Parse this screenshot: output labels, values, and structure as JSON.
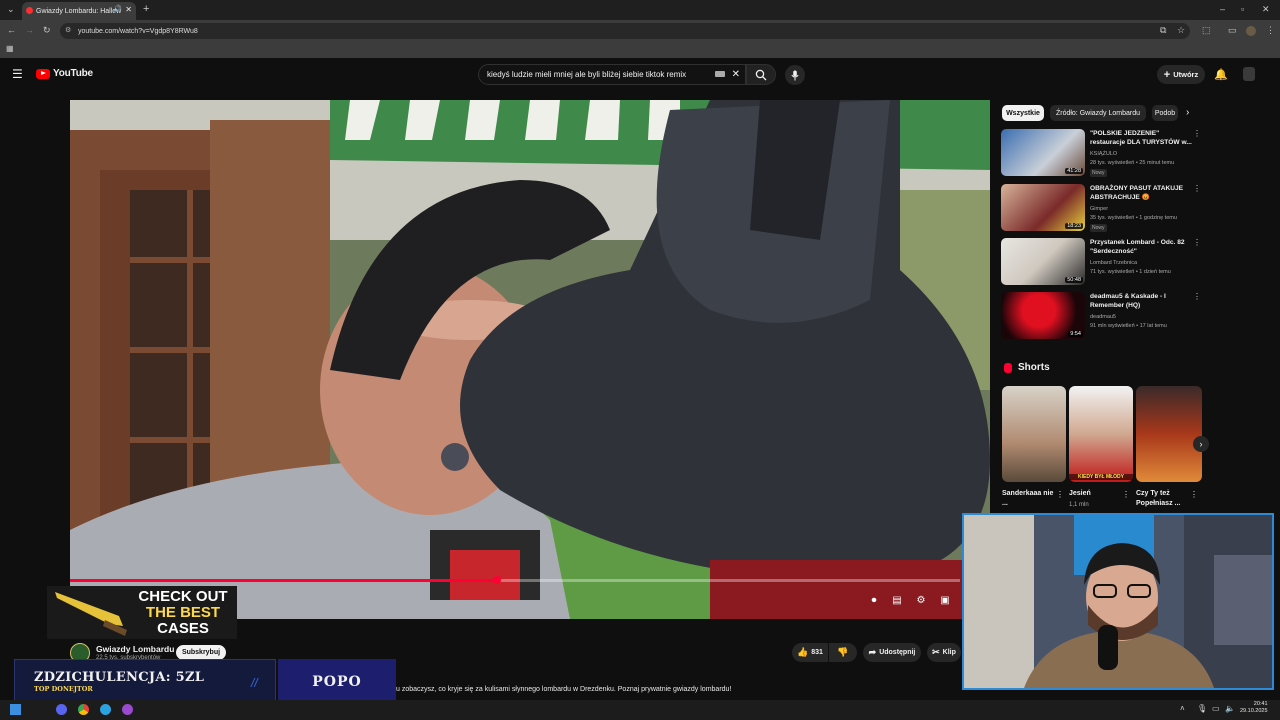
{
  "browser": {
    "tab_title": "Gwiazdy Lombardu: Hallow",
    "url": "youtube.com/watch?v=Vgdp8Y8RWu8"
  },
  "masthead": {
    "logo": "YouTube",
    "search_value": "kiedyś ludzie mieli mniej ale byli bliżej siebie tiktok remix",
    "create_label": "Utwórz"
  },
  "video": {
    "progress": 0.48,
    "accent": "#ff0033"
  },
  "channel": {
    "name": "Gwiazdy Lombardu",
    "subs": "22,5 tys. subskrybentów",
    "subscribe_label": "Subskrybuj"
  },
  "actions": {
    "likes": "831",
    "share_label": "Udostępnij",
    "clip_label": "Klip"
  },
  "description": "u zobaczysz, co kryje się za kulisami słynnego lombardu w Drezdenku. Poznaj prywatnie gwiazdy lombardu!",
  "chips": [
    "Wszystkie",
    "Źródło: Gwiazdy Lombardu",
    "Podob"
  ],
  "recommendations": [
    {
      "title": "\"POLSKIE JEDZENIE\" restauracje DLA TURYSTÓW w...",
      "channel": "KSIĄŻULO",
      "meta": "28 tys. wyświetleń • 25 minut temu",
      "badge": "Nowy",
      "duration": "41:28"
    },
    {
      "title": "OBRAŻONY PASUT ATAKUJE ABSTRACHUJE 😡",
      "channel": "Gimper",
      "meta": "35 tys. wyświetleń • 1 godzinę temu",
      "badge": "Nowy",
      "duration": "18:23"
    },
    {
      "title": "Przystanek Lombard - Odc. 82 \"Serdeczność\"",
      "channel": "Lombard Trzebnica",
      "meta": "71 tys. wyświetleń • 1 dzień temu",
      "badge": "",
      "duration": "50:48"
    },
    {
      "title": "deadmau5 & Kaskade - I Remember (HQ)",
      "channel": "deadmau5",
      "meta": "91 mln wyświetleń • 17 lat temu",
      "badge": "",
      "duration": "9:54"
    }
  ],
  "shorts": {
    "heading": "Shorts",
    "items": [
      {
        "title": "Sanderkaaa nie ...",
        "views": ""
      },
      {
        "title": "Jesień",
        "views": "1,1 mln"
      },
      {
        "title": "Czy Ty też Popełniasz ...",
        "views": ""
      }
    ],
    "short_overlay": "KIEDY BYŁ MŁODY"
  },
  "overlay": {
    "case_ad": [
      "CHECK OUT",
      "THE BEST",
      "CASES"
    ],
    "donation_title": "ZDZICHULENCJA: 5ZL",
    "donation_sub": "TOP DONEJTOR",
    "donation_right": "POPO"
  },
  "taskbar": {
    "time": "20:41",
    "date": "29.10.2025"
  }
}
